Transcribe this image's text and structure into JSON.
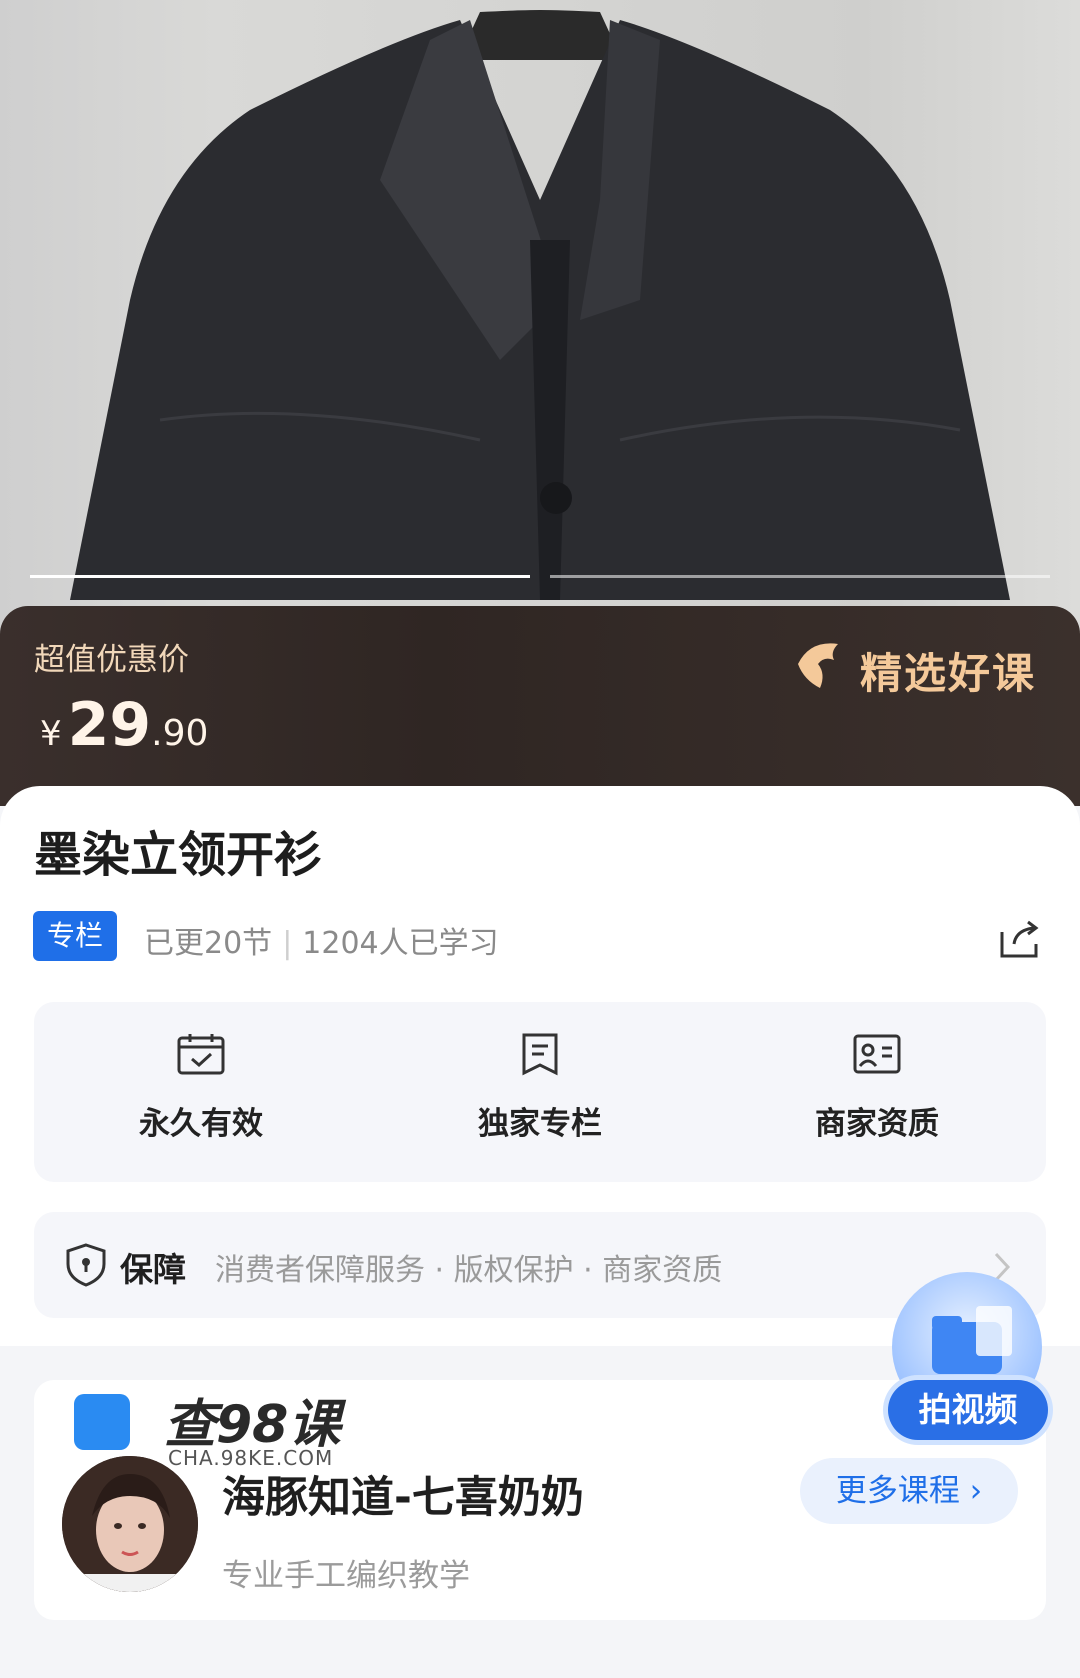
{
  "hero": {
    "image_desc": "",
    "progress_segments": 2,
    "active_segment": 1
  },
  "price": {
    "label": "超值优惠价",
    "currency": "¥",
    "integer": "29",
    "decimal": ".90"
  },
  "badge": {
    "text": "精选好课"
  },
  "course": {
    "title": "墨染立领开衫",
    "tag": "专栏",
    "lessons": "已更20节",
    "separator": "|",
    "learners": "1204人已学习"
  },
  "features": [
    {
      "label": "永久有效",
      "icon": "calendar-check-icon"
    },
    {
      "label": "独家专栏",
      "icon": "document-icon"
    },
    {
      "label": "商家资质",
      "icon": "id-card-icon"
    }
  ],
  "guarantee": {
    "title": "保障",
    "text": "消费者保障服务 · 版权保护 · 商家资质"
  },
  "author": {
    "name": "海豚知道-七喜奶奶",
    "description": "专业手工编织教学",
    "more_label": "更多课程 ›"
  },
  "watermark": {
    "text": "查98课",
    "sub": "CHA.98KE.COM"
  },
  "fab": {
    "label": "拍视频"
  },
  "colors": {
    "accent": "#1f6fe8",
    "price_band": "#2f2623",
    "badge_gold": "#f4c99a"
  }
}
